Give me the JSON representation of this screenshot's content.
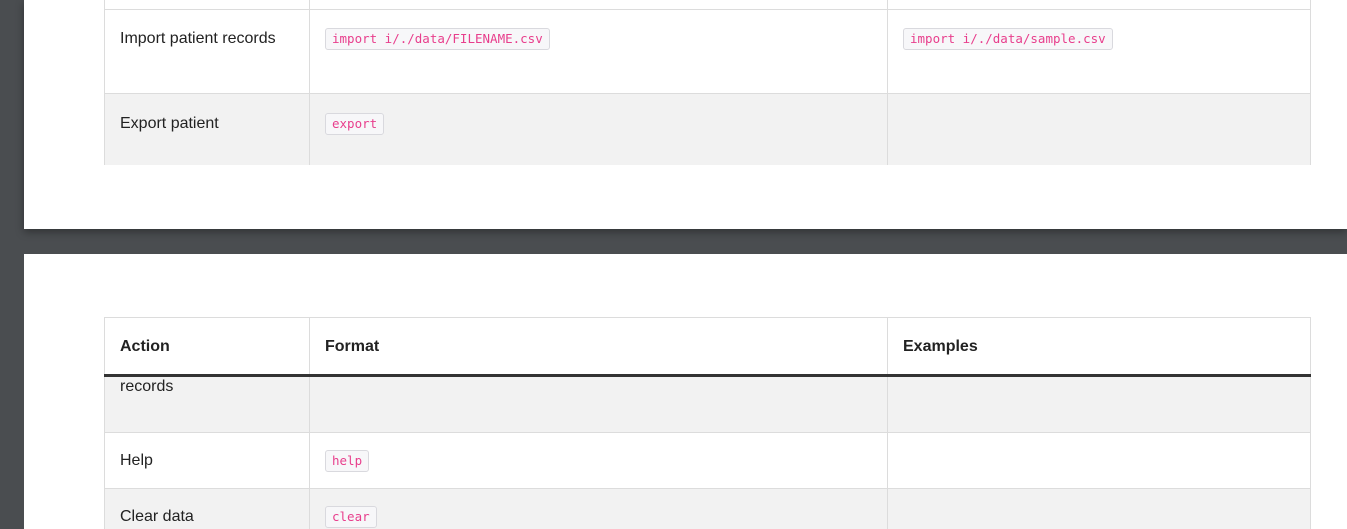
{
  "top_table": {
    "rows": [
      {
        "action": "Import patient records",
        "format": "import i/./data/FILENAME.csv",
        "example": "import i/./data/sample.csv"
      },
      {
        "action": "Export patient",
        "format": "export",
        "example": ""
      }
    ]
  },
  "bottom_table": {
    "headers": {
      "action": "Action",
      "format": "Format",
      "examples": "Examples"
    },
    "rows": [
      {
        "action": "records",
        "format": "",
        "example": ""
      },
      {
        "action": "Help",
        "format": "help",
        "example": ""
      },
      {
        "action": "Clear data",
        "format": "clear",
        "example": ""
      }
    ]
  }
}
